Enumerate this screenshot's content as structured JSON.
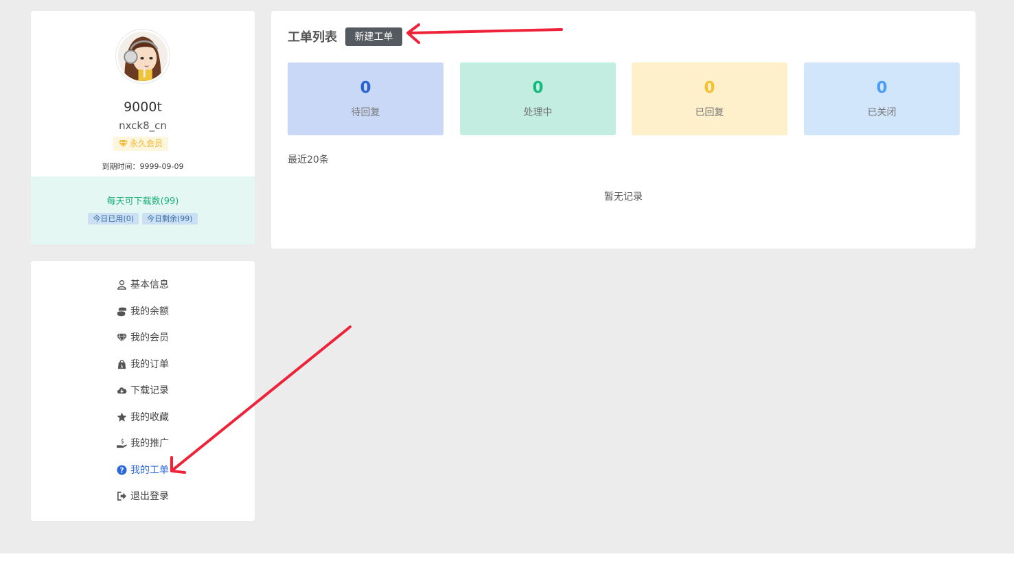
{
  "profile": {
    "display_name": "9000t",
    "username": "nxck8_cn",
    "vip_label": "永久会员",
    "expire_text": "到期时间：9999-09-09",
    "daily_quota": "每天可下载数(99)",
    "used_today": "今日已用(0)",
    "remaining_today": "今日剩余(99)"
  },
  "menu": {
    "items": [
      {
        "label": "基本信息",
        "icon": "user-icon"
      },
      {
        "label": "我的余额",
        "icon": "coins-icon"
      },
      {
        "label": "我的会员",
        "icon": "diamond-icon"
      },
      {
        "label": "我的订单",
        "icon": "shopping-bag-icon"
      },
      {
        "label": "下载记录",
        "icon": "cloud-download-icon"
      },
      {
        "label": "我的收藏",
        "icon": "star-icon"
      },
      {
        "label": "我的推广",
        "icon": "hand-dollar-icon"
      },
      {
        "label": "我的工单",
        "icon": "question-circle-icon",
        "active": true
      },
      {
        "label": "退出登录",
        "icon": "sign-out-icon"
      }
    ]
  },
  "tickets": {
    "title": "工单列表",
    "new_button": "新建工单",
    "stats": [
      {
        "value": "0",
        "label": "待回复",
        "color": "#2a62d6",
        "bg": "#c8d8f6"
      },
      {
        "value": "0",
        "label": "处理中",
        "color": "#13b97d",
        "bg": "#c2ede0"
      },
      {
        "value": "0",
        "label": "已回复",
        "color": "#f5c030",
        "bg": "#fdf0cb"
      },
      {
        "value": "0",
        "label": "已关闭",
        "color": "#4c9df5",
        "bg": "#d1e5fb"
      }
    ],
    "recent_label": "最近20条",
    "empty_text": "暂无记录"
  },
  "colors": {
    "accent": "#2a67d8",
    "annotation_arrow": "#ee2238"
  }
}
